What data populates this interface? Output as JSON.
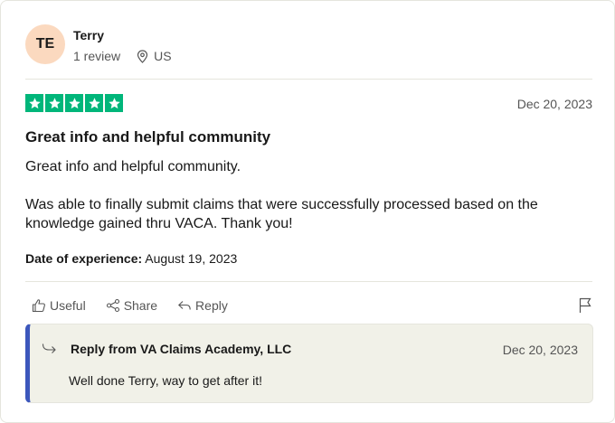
{
  "reviewer": {
    "initials": "TE",
    "name": "Terry",
    "review_count": "1 review",
    "country": "US"
  },
  "review": {
    "rating": 5,
    "date": "Dec 20, 2023",
    "title": "Great info and helpful community",
    "paragraphs": [
      "Great info and helpful community.",
      "Was able to finally submit claims that were successfully processed based on the knowledge gained thru VACA. Thank you!"
    ],
    "experience_label": "Date of experience:",
    "experience_date": "August 19, 2023"
  },
  "actions": {
    "useful": "Useful",
    "share": "Share",
    "reply": "Reply"
  },
  "company_reply": {
    "title": "Reply from VA Claims Academy, LLC",
    "date": "Dec 20, 2023",
    "text": "Well done Terry, way to get after it!"
  },
  "colors": {
    "star_green": "#00b67a",
    "avatar_bg": "#fbd9bf",
    "reply_accent": "#3c57bc",
    "reply_bg": "#f1f1e8"
  }
}
